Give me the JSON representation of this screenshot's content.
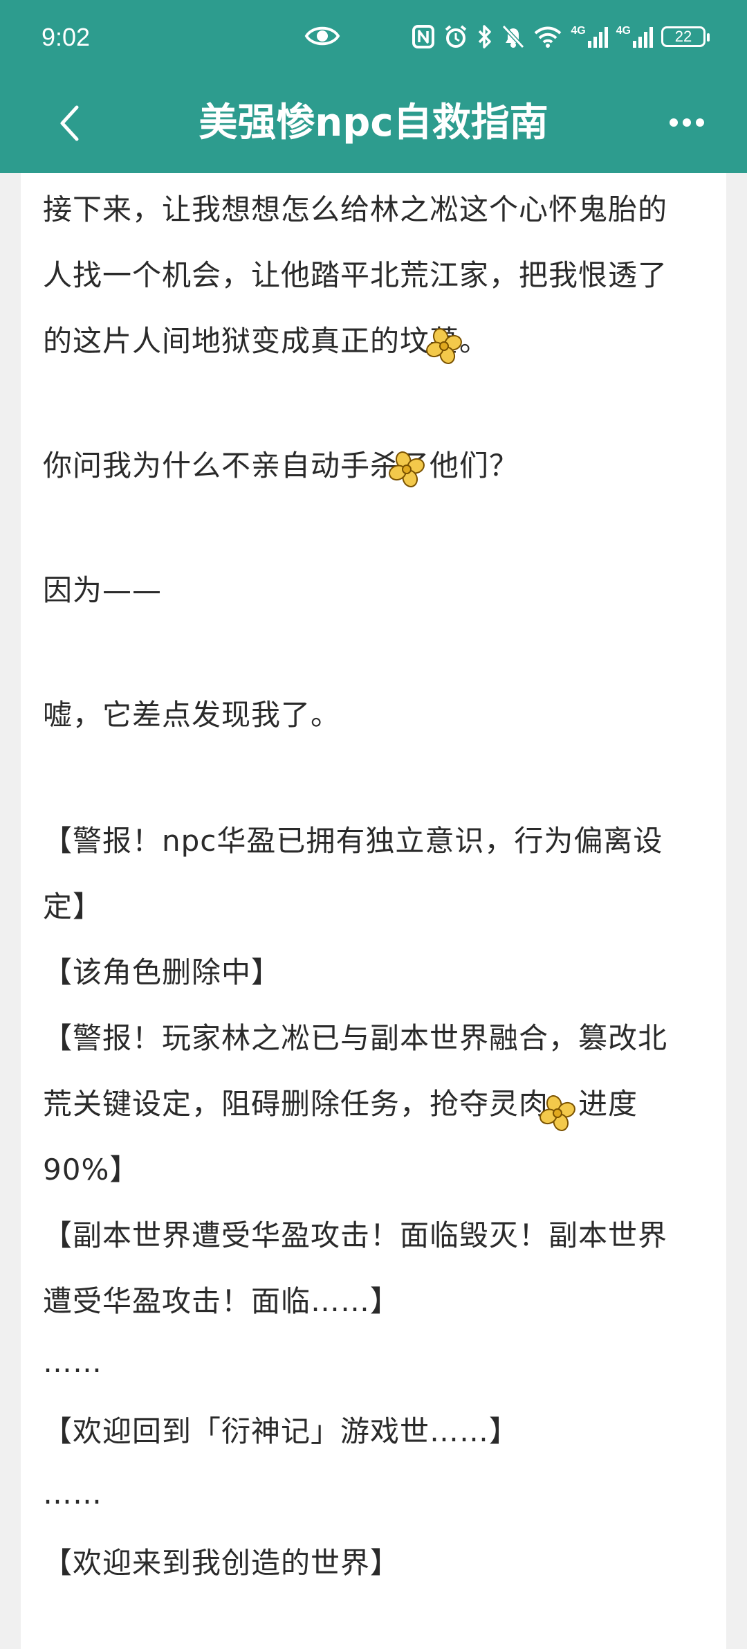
{
  "status_bar": {
    "time": "9:02",
    "network_1": "4G",
    "network_2": "4G",
    "battery": "22"
  },
  "header": {
    "title": "美强惨npc自救指南"
  },
  "reader": {
    "lines": [
      "接下来，让我想想怎么给林之凇这个心怀鬼胎的",
      "人找一个机会，让他踏平北荒江家，把我恨透了",
      "的这片人间地狱变成真正的坟墓。",
      "你问我为什么不亲自动手杀了他们？",
      "因为——",
      "嘘，它差点发现我了。",
      "【警报！npc华盈已拥有独立意识，行为偏离设",
      "定】",
      "【该角色删除中】",
      "【警报！玩家林之凇已与副本世界融合，篡改北",
      "荒关键设定，阻碍删除任务，抢夺灵肉，进度",
      "90%】",
      "【副本世界遭受华盈攻击！面临毁灭！副本世界",
      "遭受华盈攻击！面临……】",
      "……",
      "【欢迎回到「衍神记」游戏世……】",
      "……",
      "【欢迎来到我创造的世界】"
    ]
  },
  "colors": {
    "header_background": "#2d9c8e",
    "page_background": "#ffffff",
    "text": "#2a2a2a",
    "sticker_yellow": "#f3c94b"
  },
  "icons": {
    "eye": "eye-icon",
    "nfc": "nfc-icon",
    "alarm": "alarm-icon",
    "bluetooth": "bluetooth-icon",
    "mute": "mute-bell-icon",
    "wifi": "wifi-icon",
    "signal": "signal-icon",
    "back": "chevron-left-icon",
    "more": "more-dots-icon",
    "sticker": "flower-sticker-icon"
  }
}
